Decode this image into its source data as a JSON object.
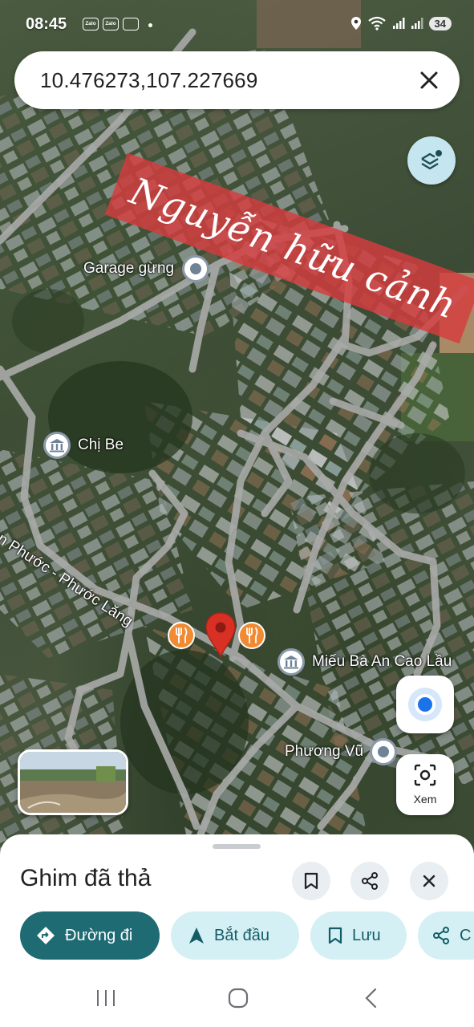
{
  "status_bar": {
    "time": "08:45",
    "apps": [
      "Zalo",
      "Zalo"
    ],
    "battery": "34"
  },
  "search": {
    "query": "10.476273,107.227669"
  },
  "watermark": {
    "text": "Nguyễn hữu cảnh"
  },
  "map": {
    "places": [
      {
        "name": "Garage gừng",
        "icon": "place-dot-icon"
      },
      {
        "name": "Chị Be",
        "icon": "temple-icon"
      },
      {
        "name": "Miếu Bà An Cao Lầu",
        "icon": "temple-icon"
      },
      {
        "name": "Phương Vũ",
        "icon": "place-dot-icon"
      }
    ],
    "road_name": "An Phước - Phước Lăng",
    "pin_color": "#d93025",
    "food_icon_color": "#f08a33"
  },
  "controls": {
    "lens_label": "Xem"
  },
  "sheet": {
    "title": "Ghim đã thả",
    "chips": [
      {
        "label": "Đường đi",
        "icon": "directions-icon"
      },
      {
        "label": "Bắt đầu",
        "icon": "navigation-arrow-icon"
      },
      {
        "label": "Lưu",
        "icon": "bookmark-icon"
      },
      {
        "label": "C",
        "icon": "share-icon"
      }
    ]
  },
  "colors": {
    "accent": "#1f6b73",
    "chip_tonal": "#d4f0f4",
    "watermark_band": "#d63c3e",
    "location_blue": "#1a73e8"
  }
}
